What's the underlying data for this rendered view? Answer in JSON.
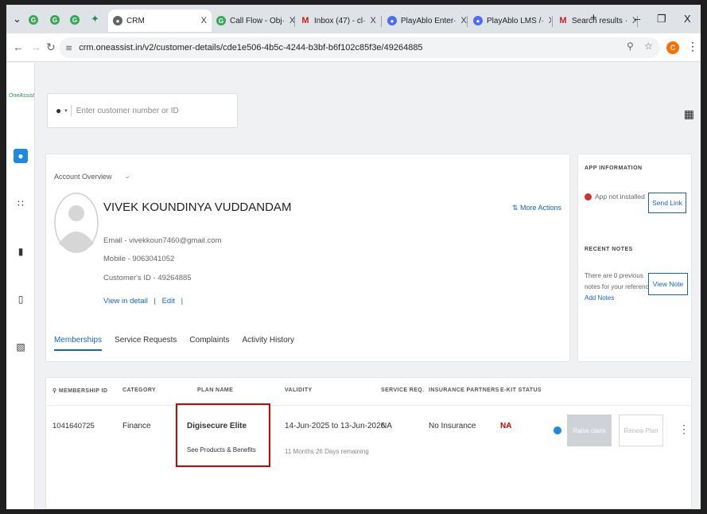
{
  "browser": {
    "tabs": [
      {
        "label": "CRM",
        "icon": "globe-icon"
      },
      {
        "label": "Call Flow - Obj·",
        "icon": "green-app-icon"
      },
      {
        "label": "Inbox (47) - cl·",
        "icon": "gmail-icon"
      },
      {
        "label": "PlayAblo Enter·",
        "icon": "playablo-icon"
      },
      {
        "label": "PlayAblo LMS /·",
        "icon": "playablo-icon"
      },
      {
        "label": "Search results ·",
        "icon": "gmail-icon"
      }
    ],
    "url": "crm.oneassist.in/v2/customer-details/cde1e506-4b5c-4244-b3bf-b6f102c85f3e/49264885",
    "profile_initial": "C"
  },
  "app": {
    "logo": "OneAssist",
    "search_placeholder": "Enter customer number or ID",
    "account_overview_label": "Account Overview",
    "customer": {
      "name": "VIVEK KOUNDINYA VUDDANDAM",
      "email": "Email - vivekkoun7460@gmail.com",
      "mobile": "Mobile - 9063041052",
      "customer_id": "Customer's ID - 49264885",
      "view_in_detail": "View in detail",
      "edit": "Edit"
    },
    "more_actions": "More Actions",
    "tabs": [
      "Memberships",
      "Service Requests",
      "Complaints",
      "Activity History"
    ],
    "app_info": {
      "heading": "APP INFORMATION",
      "status": "App not installed",
      "send_link": "Send Link",
      "recent_notes_heading": "RECENT NOTES",
      "notes_text_1": "There are 0 previous",
      "notes_text_2": "notes for your reference",
      "view_note": "View Note",
      "add_notes": "Add Notes"
    },
    "table": {
      "headers": [
        "MEMBERSHIP ID",
        "CATEGORY",
        "PLAN NAME",
        "VALIDITY",
        "SERVICE REQ.",
        "INSURANCE PARTNERS",
        "E-KIT STATUS"
      ],
      "row": {
        "membership_id": "1041640725",
        "category": "Finance",
        "plan_name": "Digisecure Elite",
        "see_products": "See Products & Benefits",
        "validity": "14-Jun-2025 to 13-Jun-2026",
        "remaining": "11 Months 26 Days remaining",
        "service_req": "NA",
        "insurance": "No Insurance",
        "ekit": "NA",
        "raise_claim": "Raise claim",
        "renew_plan": "Renew Plan"
      }
    }
  },
  "colors": {
    "accent": "#1565c0",
    "danger": "#d50000",
    "sidebar_active": "#1e88e5"
  }
}
